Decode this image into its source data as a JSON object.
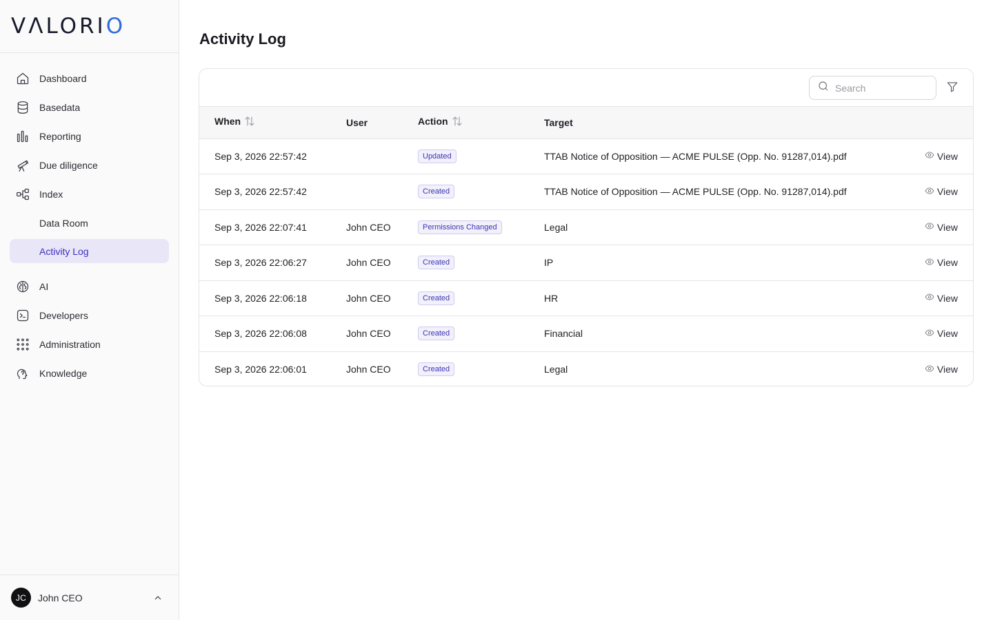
{
  "brand": {
    "logo_pre": "V",
    "logo_a": "Λ",
    "logo_mid": "LORI",
    "logo_o": "O",
    "accent_color": "#2f6bdc"
  },
  "sidebar": {
    "items": [
      {
        "label": "Dashboard",
        "icon": "house-icon"
      },
      {
        "label": "Basedata",
        "icon": "database-icon"
      },
      {
        "label": "Reporting",
        "icon": "bar-chart-icon"
      },
      {
        "label": "Due diligence",
        "icon": "telescope-icon"
      },
      {
        "label": "Index",
        "icon": "network-icon"
      },
      {
        "label": "Data Room",
        "icon": ""
      },
      {
        "label": "Activity Log",
        "icon": "",
        "active": true
      },
      {
        "label": "AI",
        "icon": "brain-icon"
      },
      {
        "label": "Developers",
        "icon": "terminal-icon"
      },
      {
        "label": "Administration",
        "icon": "grid-icon"
      },
      {
        "label": "Knowledge",
        "icon": "head-icon"
      }
    ],
    "user": {
      "initials": "JC",
      "name": "John CEO"
    }
  },
  "main": {
    "title": "Activity Log",
    "search_placeholder": "Search",
    "columns": {
      "when": "When",
      "user": "User",
      "action": "Action",
      "target": "Target"
    },
    "view_label": "View",
    "rows": [
      {
        "when": "Sep 3, 2026 22:57:42",
        "user": "",
        "action": "Updated",
        "target": "TTAB Notice of Opposition — ACME PULSE (Opp. No. 91287,014).pdf"
      },
      {
        "when": "Sep 3, 2026 22:57:42",
        "user": "",
        "action": "Created",
        "target": "TTAB Notice of Opposition — ACME PULSE (Opp. No. 91287,014).pdf"
      },
      {
        "when": "Sep 3, 2026 22:07:41",
        "user": "John CEO",
        "action": "Permissions Changed",
        "target": "Legal"
      },
      {
        "when": "Sep 3, 2026 22:06:27",
        "user": "John CEO",
        "action": "Created",
        "target": "IP"
      },
      {
        "when": "Sep 3, 2026 22:06:18",
        "user": "John CEO",
        "action": "Created",
        "target": "HR"
      },
      {
        "when": "Sep 3, 2026 22:06:08",
        "user": "John CEO",
        "action": "Created",
        "target": "Financial"
      },
      {
        "when": "Sep 3, 2026 22:06:01",
        "user": "John CEO",
        "action": "Created",
        "target": "Legal"
      }
    ]
  }
}
